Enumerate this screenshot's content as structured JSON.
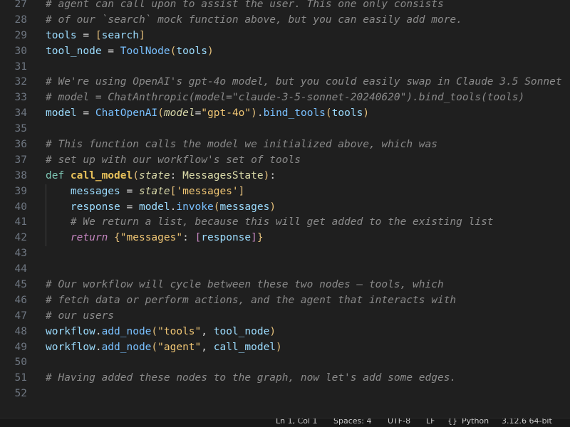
{
  "editor": {
    "lines": [
      {
        "n": "27",
        "segs": [
          {
            "t": "# agent can call upon to assist the user. This one only consists",
            "c": "cm"
          }
        ]
      },
      {
        "n": "28",
        "segs": [
          {
            "t": "# of our `search` mock function above, but you can easily add more.",
            "c": "cm"
          }
        ]
      },
      {
        "n": "29",
        "segs": [
          {
            "t": "tools",
            "c": "var"
          },
          {
            "t": " = ",
            "c": "op"
          },
          {
            "t": "[",
            "c": "brk"
          },
          {
            "t": "search",
            "c": "var"
          },
          {
            "t": "]",
            "c": "brk"
          }
        ]
      },
      {
        "n": "30",
        "segs": [
          {
            "t": "tool_node",
            "c": "var"
          },
          {
            "t": " = ",
            "c": "op"
          },
          {
            "t": "ToolNode",
            "c": "cls"
          },
          {
            "t": "(",
            "c": "brk"
          },
          {
            "t": "tools",
            "c": "var"
          },
          {
            "t": ")",
            "c": "brk"
          }
        ]
      },
      {
        "n": "31",
        "segs": []
      },
      {
        "n": "32",
        "segs": [
          {
            "t": "# We're using OpenAI's gpt-4o model, but you could easily swap in Claude 3.5 Sonnet",
            "c": "cm"
          }
        ]
      },
      {
        "n": "33",
        "segs": [
          {
            "t": "# model = ChatAnthropic(model=\"claude-3-5-sonnet-20240620\").bind_tools(tools)",
            "c": "cm"
          }
        ]
      },
      {
        "n": "34",
        "segs": [
          {
            "t": "model",
            "c": "var"
          },
          {
            "t": " = ",
            "c": "op"
          },
          {
            "t": "ChatOpenAI",
            "c": "cls"
          },
          {
            "t": "(",
            "c": "brk"
          },
          {
            "t": "model",
            "c": "par"
          },
          {
            "t": "=",
            "c": "op"
          },
          {
            "t": "\"gpt-4o\"",
            "c": "str"
          },
          {
            "t": ")",
            "c": "brk"
          },
          {
            "t": ".",
            "c": "op"
          },
          {
            "t": "bind_tools",
            "c": "meth"
          },
          {
            "t": "(",
            "c": "brk"
          },
          {
            "t": "tools",
            "c": "var"
          },
          {
            "t": ")",
            "c": "brk"
          }
        ]
      },
      {
        "n": "35",
        "segs": []
      },
      {
        "n": "36",
        "segs": [
          {
            "t": "# This function calls the model we initialized above, which was",
            "c": "cm"
          }
        ]
      },
      {
        "n": "37",
        "segs": [
          {
            "t": "# set up with our workflow's set of tools",
            "c": "cm"
          }
        ]
      },
      {
        "n": "38",
        "segs": [
          {
            "t": "def ",
            "c": "kw"
          },
          {
            "t": "call_model",
            "c": "fn"
          },
          {
            "t": "(",
            "c": "brk"
          },
          {
            "t": "state",
            "c": "par"
          },
          {
            "t": ": ",
            "c": "op"
          },
          {
            "t": "MessagesState",
            "c": "typ"
          },
          {
            "t": ")",
            "c": "brk"
          },
          {
            "t": ":",
            "c": "op"
          }
        ]
      },
      {
        "n": "39",
        "guide": true,
        "segs": [
          {
            "t": "    messages",
            "c": "var"
          },
          {
            "t": " = ",
            "c": "op"
          },
          {
            "t": "state",
            "c": "par"
          },
          {
            "t": "[",
            "c": "brk"
          },
          {
            "t": "'messages'",
            "c": "str"
          },
          {
            "t": "]",
            "c": "brk"
          }
        ]
      },
      {
        "n": "40",
        "guide": true,
        "segs": [
          {
            "t": "    response",
            "c": "var"
          },
          {
            "t": " = ",
            "c": "op"
          },
          {
            "t": "model",
            "c": "var"
          },
          {
            "t": ".",
            "c": "op"
          },
          {
            "t": "invoke",
            "c": "meth"
          },
          {
            "t": "(",
            "c": "brk"
          },
          {
            "t": "messages",
            "c": "var"
          },
          {
            "t": ")",
            "c": "brk"
          }
        ]
      },
      {
        "n": "41",
        "guide": true,
        "segs": [
          {
            "t": "    # We return a list, because this will get added to the existing list",
            "c": "cm"
          }
        ]
      },
      {
        "n": "42",
        "guide": true,
        "segs": [
          {
            "t": "    ",
            "c": "op"
          },
          {
            "t": "return",
            "c": "ret"
          },
          {
            "t": " {",
            "c": "brk"
          },
          {
            "t": "\"messages\"",
            "c": "str"
          },
          {
            "t": ": ",
            "c": "op"
          },
          {
            "t": "[",
            "c": "br2"
          },
          {
            "t": "response",
            "c": "var"
          },
          {
            "t": "]",
            "c": "br2"
          },
          {
            "t": "}",
            "c": "brk"
          }
        ]
      },
      {
        "n": "43",
        "segs": []
      },
      {
        "n": "44",
        "segs": []
      },
      {
        "n": "45",
        "segs": [
          {
            "t": "# Our workflow will cycle between these two nodes — tools, which",
            "c": "cm"
          }
        ]
      },
      {
        "n": "46",
        "segs": [
          {
            "t": "# fetch data or perform actions, and the agent that interacts with",
            "c": "cm"
          }
        ]
      },
      {
        "n": "47",
        "segs": [
          {
            "t": "# our users",
            "c": "cm"
          }
        ]
      },
      {
        "n": "48",
        "segs": [
          {
            "t": "workflow",
            "c": "var"
          },
          {
            "t": ".",
            "c": "op"
          },
          {
            "t": "add_node",
            "c": "meth"
          },
          {
            "t": "(",
            "c": "brk"
          },
          {
            "t": "\"tools\"",
            "c": "str"
          },
          {
            "t": ", ",
            "c": "op"
          },
          {
            "t": "tool_node",
            "c": "var"
          },
          {
            "t": ")",
            "c": "brk"
          }
        ]
      },
      {
        "n": "49",
        "segs": [
          {
            "t": "workflow",
            "c": "var"
          },
          {
            "t": ".",
            "c": "op"
          },
          {
            "t": "add_node",
            "c": "meth"
          },
          {
            "t": "(",
            "c": "brk"
          },
          {
            "t": "\"agent\"",
            "c": "str"
          },
          {
            "t": ", ",
            "c": "op"
          },
          {
            "t": "call_model",
            "c": "var"
          },
          {
            "t": ")",
            "c": "brk"
          }
        ]
      },
      {
        "n": "50",
        "segs": []
      },
      {
        "n": "51",
        "segs": [
          {
            "t": "# Having added these nodes to the graph, now let's add some edges.",
            "c": "cm"
          }
        ]
      },
      {
        "n": "52",
        "segs": []
      }
    ]
  },
  "statusbar": {
    "position": "Ln 1, Col 1",
    "spaces": "Spaces: 4",
    "encoding": "UTF-8",
    "eol": "LF",
    "language_icon": "braces-icon",
    "language": "Python",
    "interpreter": "3.12.6 64-bit"
  }
}
